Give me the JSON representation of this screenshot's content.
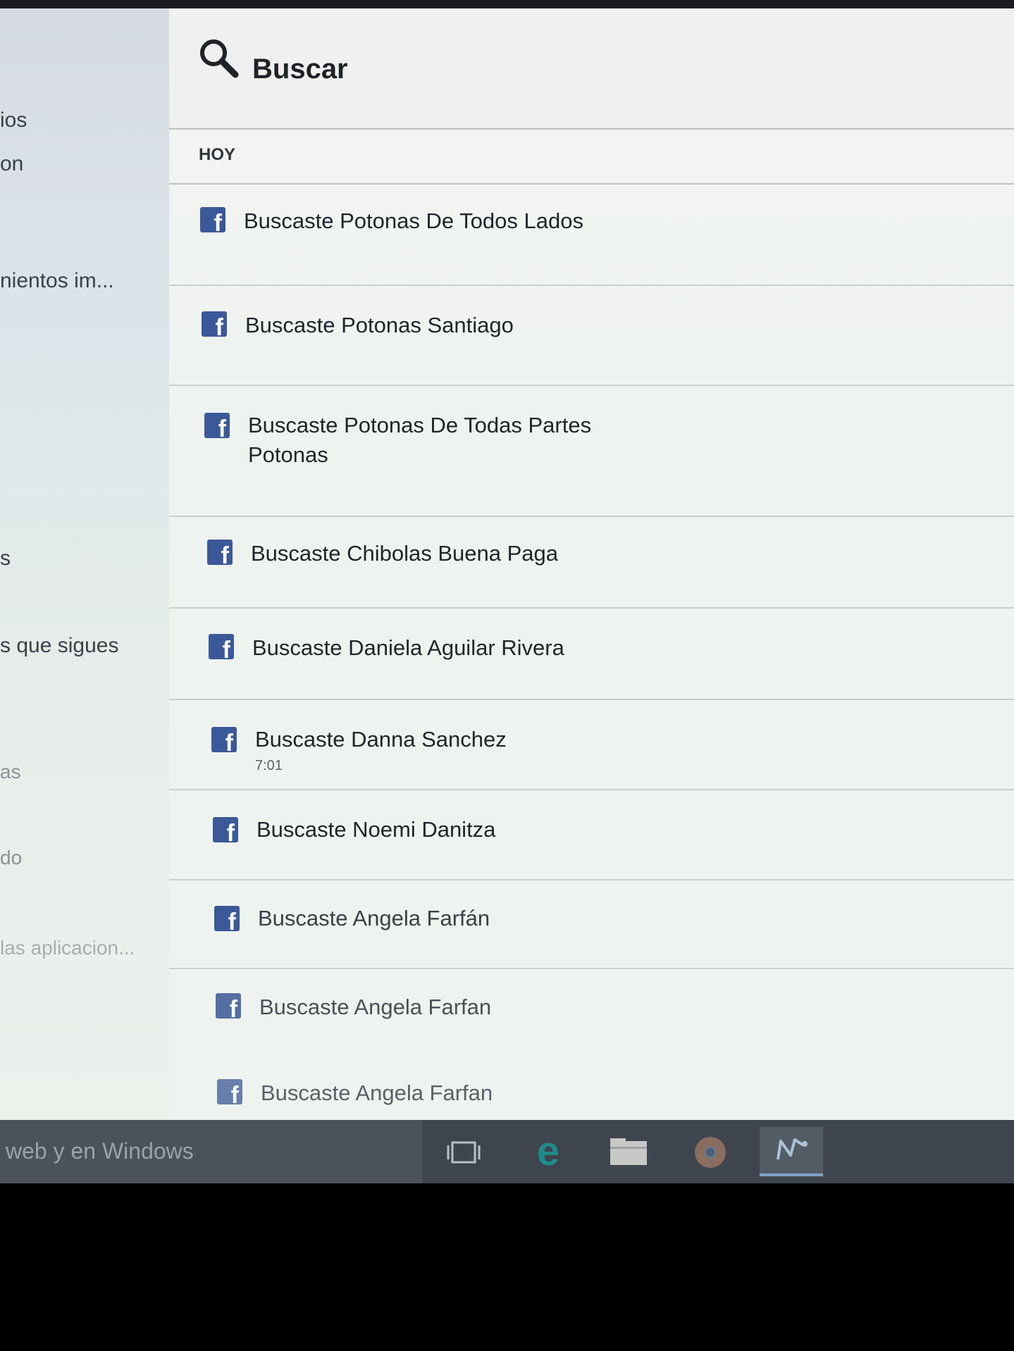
{
  "left_panel": {
    "items": [
      {
        "label": "ios"
      },
      {
        "label": "on"
      },
      {
        "label": "nientos im..."
      },
      {
        "label": "s"
      },
      {
        "label": "s que sigues"
      },
      {
        "label": "as"
      },
      {
        "label": "do"
      },
      {
        "label": "las aplicacion..."
      }
    ]
  },
  "search": {
    "title": "Buscar",
    "section_label": "HOY",
    "results": [
      {
        "lines": [
          "Buscaste Potonas De Todos Lados"
        ],
        "subtext": ""
      },
      {
        "lines": [
          "Buscaste Potonas Santiago"
        ],
        "subtext": ""
      },
      {
        "lines": [
          "Buscaste Potonas De Todas Partes",
          "Potonas"
        ],
        "subtext": ""
      },
      {
        "lines": [
          "Buscaste Chibolas Buena Paga"
        ],
        "subtext": ""
      },
      {
        "lines": [
          "Buscaste Daniela Aguilar Rivera"
        ],
        "subtext": ""
      },
      {
        "lines": [
          "Buscaste Danna Sanchez"
        ],
        "subtext": "7:01"
      },
      {
        "lines": [
          "Buscaste Noemi Danitza"
        ],
        "subtext": ""
      },
      {
        "lines": [
          "Buscaste Angela Farfán"
        ],
        "subtext": ""
      },
      {
        "lines": [
          "Buscaste Angela Farfan"
        ],
        "subtext": ""
      },
      {
        "lines": [
          "Buscaste Angela Farfan"
        ],
        "subtext": ""
      }
    ]
  },
  "taskbar": {
    "search_text": "web y en Windows",
    "buttons": [
      {
        "icon": "task-view-icon"
      },
      {
        "icon": "edge-browser-icon"
      },
      {
        "icon": "file-explorer-icon"
      },
      {
        "icon": "chrome-icon"
      },
      {
        "icon": "app-icon"
      }
    ]
  },
  "colors": {
    "facebook_blue": "#3b5998",
    "taskbar": "#3f454e",
    "edge_teal": "#1f8b8b"
  }
}
